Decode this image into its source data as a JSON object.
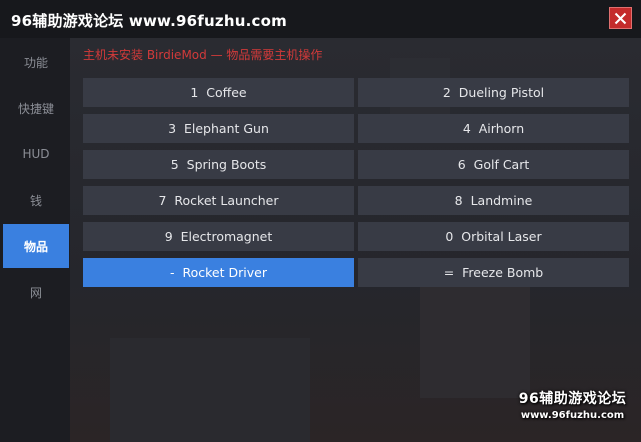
{
  "window": {
    "title": "96辅助游戏论坛 www.96fuzhu.com"
  },
  "sidebar": {
    "items": [
      {
        "label": "功能",
        "active": false
      },
      {
        "label": "快捷键",
        "active": false
      },
      {
        "label": "HUD",
        "active": false
      },
      {
        "label": "钱",
        "active": false
      },
      {
        "label": "物品",
        "active": true
      },
      {
        "label": "网",
        "active": false
      }
    ]
  },
  "main": {
    "notice": "主机未安装 BirdieMod — 物品需要主机操作",
    "items": [
      {
        "label": "1  Coffee",
        "selected": false
      },
      {
        "label": "2  Dueling Pistol",
        "selected": false
      },
      {
        "label": "3  Elephant Gun",
        "selected": false
      },
      {
        "label": "4  Airhorn",
        "selected": false
      },
      {
        "label": "5  Spring Boots",
        "selected": false
      },
      {
        "label": "6  Golf Cart",
        "selected": false
      },
      {
        "label": "7  Rocket Launcher",
        "selected": false
      },
      {
        "label": "8  Landmine",
        "selected": false
      },
      {
        "label": "9  Electromagnet",
        "selected": false
      },
      {
        "label": "0  Orbital Laser",
        "selected": false
      },
      {
        "label": "-  Rocket Driver",
        "selected": true
      },
      {
        "label": "=  Freeze Bomb",
        "selected": false
      }
    ]
  },
  "watermark": {
    "line1": "96辅助游戏论坛",
    "line2": "www.96fuzhu.com"
  },
  "colors": {
    "accent": "#3a80e0",
    "notice": "#d23a3a",
    "close": "#c42b2b"
  }
}
